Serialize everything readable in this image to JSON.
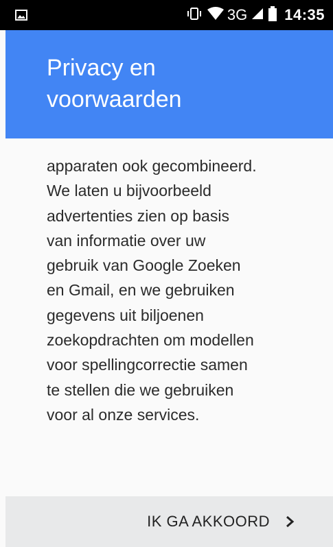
{
  "status_bar": {
    "network": "3G",
    "time": "14:35",
    "icons": [
      "image-notification-icon",
      "vibrate-icon",
      "wifi-icon",
      "signal-icon",
      "battery-icon"
    ]
  },
  "app_bar": {
    "title": "Privacy en voorwaarden",
    "color": "#4285f4"
  },
  "content": {
    "lines": [
      "apparaten ook gecombineerd.",
      "We laten u bijvoorbeeld",
      "advertenties zien op basis",
      "van informatie over uw",
      "gebruik van Google Zoeken",
      "en Gmail, en we gebruiken",
      "gegevens uit biljoenen",
      "zoekopdrachten om modellen",
      "voor spellingcorrectie samen",
      "te stellen die we gebruiken",
      "voor al onze services."
    ]
  },
  "footer": {
    "agree_label": "IK GA AKKOORD",
    "agree_icon": "chevron-right-icon"
  }
}
